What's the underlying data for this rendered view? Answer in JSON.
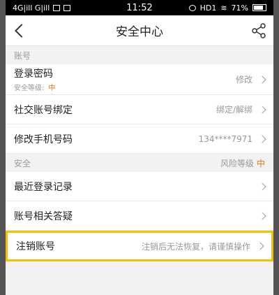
{
  "status": {
    "left": "4G|ill G|ill",
    "time": "11:52",
    "hd": "HD1",
    "battery": "71%"
  },
  "nav": {
    "title": "安全中心"
  },
  "sections": {
    "account": "账号",
    "security": "安全",
    "risk_label": "风险等级",
    "risk_value": "中"
  },
  "rows": {
    "password": {
      "label": "登录密码",
      "sub_label": "安全等级:",
      "sub_value": "中",
      "value": "修改"
    },
    "social": {
      "label": "社交账号绑定",
      "value": "绑定/解绑"
    },
    "phone": {
      "label": "修改手机号码",
      "value": "134****7971"
    },
    "recent": {
      "label": "最近登录记录"
    },
    "faq": {
      "label": "账号相关答疑"
    },
    "cancel": {
      "label": "注销账号",
      "value": "注销后无法恢复，请谨慎操作"
    }
  }
}
